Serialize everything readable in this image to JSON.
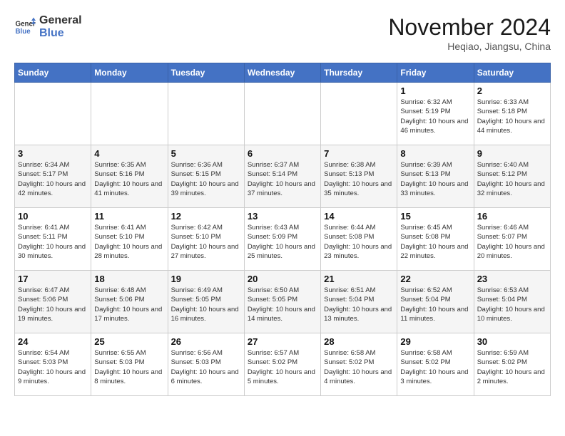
{
  "logo": {
    "line1": "General",
    "line2": "Blue"
  },
  "title": "November 2024",
  "location": "Heqiao, Jiangsu, China",
  "weekdays": [
    "Sunday",
    "Monday",
    "Tuesday",
    "Wednesday",
    "Thursday",
    "Friday",
    "Saturday"
  ],
  "weeks": [
    [
      {
        "day": "",
        "info": ""
      },
      {
        "day": "",
        "info": ""
      },
      {
        "day": "",
        "info": ""
      },
      {
        "day": "",
        "info": ""
      },
      {
        "day": "",
        "info": ""
      },
      {
        "day": "1",
        "info": "Sunrise: 6:32 AM\nSunset: 5:19 PM\nDaylight: 10 hours and 46 minutes."
      },
      {
        "day": "2",
        "info": "Sunrise: 6:33 AM\nSunset: 5:18 PM\nDaylight: 10 hours and 44 minutes."
      }
    ],
    [
      {
        "day": "3",
        "info": "Sunrise: 6:34 AM\nSunset: 5:17 PM\nDaylight: 10 hours and 42 minutes."
      },
      {
        "day": "4",
        "info": "Sunrise: 6:35 AM\nSunset: 5:16 PM\nDaylight: 10 hours and 41 minutes."
      },
      {
        "day": "5",
        "info": "Sunrise: 6:36 AM\nSunset: 5:15 PM\nDaylight: 10 hours and 39 minutes."
      },
      {
        "day": "6",
        "info": "Sunrise: 6:37 AM\nSunset: 5:14 PM\nDaylight: 10 hours and 37 minutes."
      },
      {
        "day": "7",
        "info": "Sunrise: 6:38 AM\nSunset: 5:13 PM\nDaylight: 10 hours and 35 minutes."
      },
      {
        "day": "8",
        "info": "Sunrise: 6:39 AM\nSunset: 5:13 PM\nDaylight: 10 hours and 33 minutes."
      },
      {
        "day": "9",
        "info": "Sunrise: 6:40 AM\nSunset: 5:12 PM\nDaylight: 10 hours and 32 minutes."
      }
    ],
    [
      {
        "day": "10",
        "info": "Sunrise: 6:41 AM\nSunset: 5:11 PM\nDaylight: 10 hours and 30 minutes."
      },
      {
        "day": "11",
        "info": "Sunrise: 6:41 AM\nSunset: 5:10 PM\nDaylight: 10 hours and 28 minutes."
      },
      {
        "day": "12",
        "info": "Sunrise: 6:42 AM\nSunset: 5:10 PM\nDaylight: 10 hours and 27 minutes."
      },
      {
        "day": "13",
        "info": "Sunrise: 6:43 AM\nSunset: 5:09 PM\nDaylight: 10 hours and 25 minutes."
      },
      {
        "day": "14",
        "info": "Sunrise: 6:44 AM\nSunset: 5:08 PM\nDaylight: 10 hours and 23 minutes."
      },
      {
        "day": "15",
        "info": "Sunrise: 6:45 AM\nSunset: 5:08 PM\nDaylight: 10 hours and 22 minutes."
      },
      {
        "day": "16",
        "info": "Sunrise: 6:46 AM\nSunset: 5:07 PM\nDaylight: 10 hours and 20 minutes."
      }
    ],
    [
      {
        "day": "17",
        "info": "Sunrise: 6:47 AM\nSunset: 5:06 PM\nDaylight: 10 hours and 19 minutes."
      },
      {
        "day": "18",
        "info": "Sunrise: 6:48 AM\nSunset: 5:06 PM\nDaylight: 10 hours and 17 minutes."
      },
      {
        "day": "19",
        "info": "Sunrise: 6:49 AM\nSunset: 5:05 PM\nDaylight: 10 hours and 16 minutes."
      },
      {
        "day": "20",
        "info": "Sunrise: 6:50 AM\nSunset: 5:05 PM\nDaylight: 10 hours and 14 minutes."
      },
      {
        "day": "21",
        "info": "Sunrise: 6:51 AM\nSunset: 5:04 PM\nDaylight: 10 hours and 13 minutes."
      },
      {
        "day": "22",
        "info": "Sunrise: 6:52 AM\nSunset: 5:04 PM\nDaylight: 10 hours and 11 minutes."
      },
      {
        "day": "23",
        "info": "Sunrise: 6:53 AM\nSunset: 5:04 PM\nDaylight: 10 hours and 10 minutes."
      }
    ],
    [
      {
        "day": "24",
        "info": "Sunrise: 6:54 AM\nSunset: 5:03 PM\nDaylight: 10 hours and 9 minutes."
      },
      {
        "day": "25",
        "info": "Sunrise: 6:55 AM\nSunset: 5:03 PM\nDaylight: 10 hours and 8 minutes."
      },
      {
        "day": "26",
        "info": "Sunrise: 6:56 AM\nSunset: 5:03 PM\nDaylight: 10 hours and 6 minutes."
      },
      {
        "day": "27",
        "info": "Sunrise: 6:57 AM\nSunset: 5:02 PM\nDaylight: 10 hours and 5 minutes."
      },
      {
        "day": "28",
        "info": "Sunrise: 6:58 AM\nSunset: 5:02 PM\nDaylight: 10 hours and 4 minutes."
      },
      {
        "day": "29",
        "info": "Sunrise: 6:58 AM\nSunset: 5:02 PM\nDaylight: 10 hours and 3 minutes."
      },
      {
        "day": "30",
        "info": "Sunrise: 6:59 AM\nSunset: 5:02 PM\nDaylight: 10 hours and 2 minutes."
      }
    ]
  ]
}
